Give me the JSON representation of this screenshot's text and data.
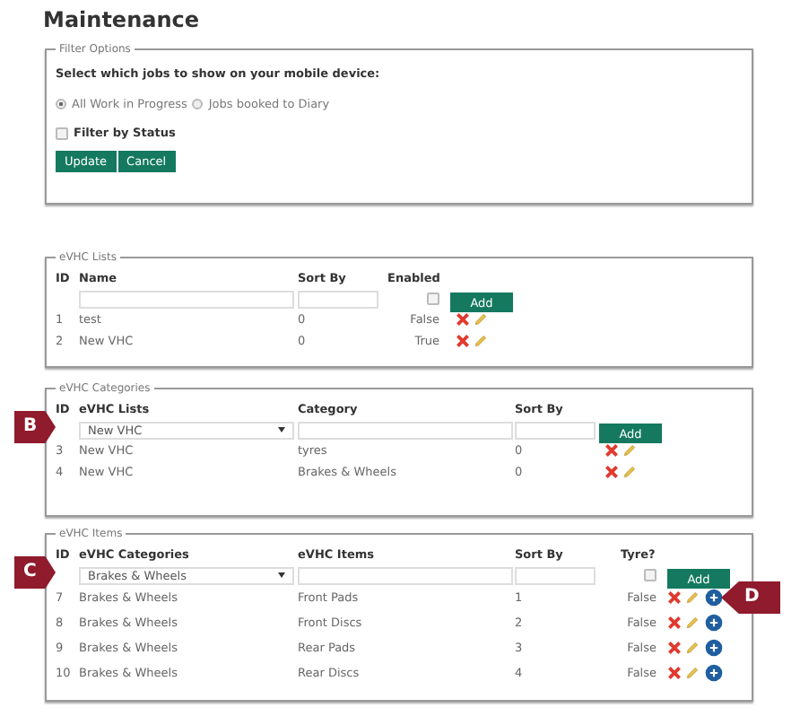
{
  "title": "Maintenance",
  "filter_options": {
    "legend": "Filter Options",
    "prompt": "Select which jobs to show on your mobile device:",
    "radios": [
      {
        "label": "All Work in Progress",
        "selected": true
      },
      {
        "label": "Jobs booked to Diary",
        "selected": false
      }
    ],
    "filter_by_status": {
      "label": "Filter by Status",
      "checked": false
    },
    "buttons": [
      "Update",
      "Cancel"
    ]
  },
  "evhc_lists": {
    "legend": "eVHC Lists",
    "columns": [
      "ID",
      "Name",
      "Sort By",
      "Enabled"
    ],
    "new_row": {
      "enabled": false,
      "button": "Add"
    },
    "rows": [
      {
        "id": "1",
        "name": "test",
        "sort_by": "0",
        "enabled": "False"
      },
      {
        "id": "2",
        "name": "New VHC",
        "sort_by": "0",
        "enabled": "True"
      }
    ]
  },
  "evhc_categories": {
    "legend": "eVHC Categories",
    "columns": [
      "ID",
      "eVHC Lists",
      "Category",
      "Sort By"
    ],
    "new_row": {
      "list": "New VHC",
      "button": "Add",
      "callout": "B"
    },
    "rows": [
      {
        "id": "3",
        "list": "New VHC",
        "category": "tyres",
        "sort_by": "0"
      },
      {
        "id": "4",
        "list": "New VHC",
        "category": "Brakes & Wheels",
        "sort_by": "0"
      }
    ]
  },
  "evhc_items": {
    "legend": "eVHC Items",
    "columns": [
      "ID",
      "eVHC Categories",
      "eVHC Items",
      "Sort By",
      "Tyre?"
    ],
    "new_row": {
      "category": "Brakes & Wheels",
      "tyre": false,
      "button": "Add",
      "callout": "C"
    },
    "rows": [
      {
        "id": "7",
        "category": "Brakes & Wheels",
        "item": "Front Pads",
        "sort_by": "1",
        "tyre": "False",
        "callout": "D"
      },
      {
        "id": "8",
        "category": "Brakes & Wheels",
        "item": "Front Discs",
        "sort_by": "2",
        "tyre": "False"
      },
      {
        "id": "9",
        "category": "Brakes & Wheels",
        "item": "Rear Pads",
        "sort_by": "3",
        "tyre": "False"
      },
      {
        "id": "10",
        "category": "Brakes & Wheels",
        "item": "Rear Discs",
        "sort_by": "4",
        "tyre": "False"
      }
    ]
  }
}
